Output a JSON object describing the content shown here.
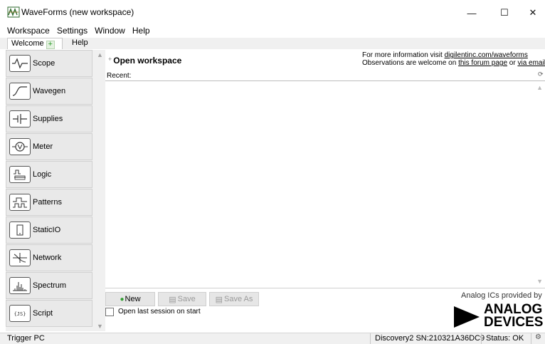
{
  "window": {
    "title": "WaveForms  (new workspace)",
    "min_glyph": "—",
    "max_glyph": "☐",
    "close_glyph": "✕"
  },
  "menu": [
    "Workspace",
    "Settings",
    "Window",
    "Help"
  ],
  "tabs": {
    "welcome": "Welcome",
    "plus": "+",
    "help": "Help"
  },
  "sidebar": {
    "items": [
      {
        "label": "Scope",
        "icon": "scope-icon"
      },
      {
        "label": "Wavegen",
        "icon": "wavegen-icon"
      },
      {
        "label": "Supplies",
        "icon": "supplies-icon"
      },
      {
        "label": "Meter",
        "icon": "meter-icon"
      },
      {
        "label": "Logic",
        "icon": "logic-icon"
      },
      {
        "label": "Patterns",
        "icon": "patterns-icon"
      },
      {
        "label": "StaticIO",
        "icon": "staticio-icon"
      },
      {
        "label": "Network",
        "icon": "network-icon"
      },
      {
        "label": "Spectrum",
        "icon": "spectrum-icon"
      },
      {
        "label": "Script",
        "icon": "script-icon"
      }
    ]
  },
  "main": {
    "title": "Open workspace",
    "info_line1_prefix": "For more information visit ",
    "info_line1_link": "digilentinc.com/waveforms",
    "info_line2_prefix": "Observations are welcome on ",
    "info_line2_link1": "this forum page",
    "info_line2_mid": " or ",
    "info_line2_link2": "via email",
    "recent_label": "Recent:",
    "buttons": {
      "new": "New",
      "save": "Save",
      "save_as": "Save As"
    },
    "open_last_label": "Open last session on start",
    "adi_caption": "Analog ICs provided by",
    "adi_line1": "ANALOG",
    "adi_line2": "DEVICES"
  },
  "status": {
    "left": "Trigger PC",
    "device": "Discovery2 SN:210321A36DC9",
    "status": "Status: OK"
  },
  "colors": {
    "accent_green": "#33a033",
    "sidebar_bg": "#f0f0f0"
  }
}
